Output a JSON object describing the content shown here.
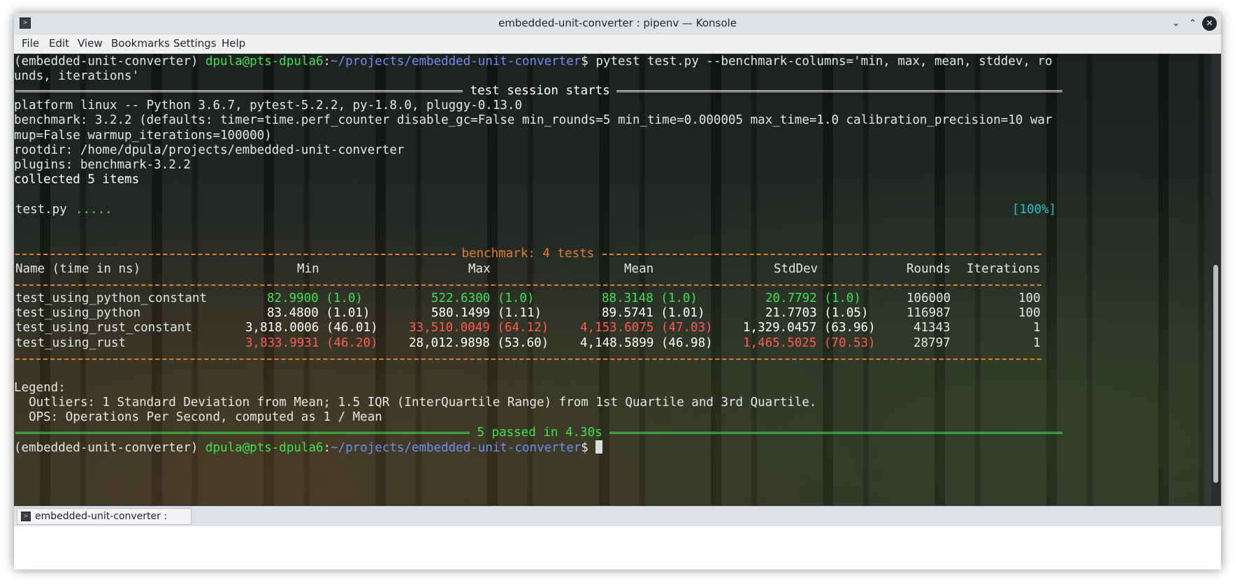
{
  "window": {
    "title": "embedded-unit-converter : pipenv — Konsole",
    "controls": {
      "minimize": "⌄",
      "maximize": "⌃",
      "close": "✕"
    }
  },
  "menu": [
    "File",
    "Edit",
    "View",
    "Bookmarks",
    "Settings",
    "Help"
  ],
  "prompt": {
    "env": "(embedded-unit-converter) ",
    "user_host": "dpula@pts-dpula6",
    "colon": ":",
    "path": "~/projects/embedded-unit-converter",
    "dollar": "$ "
  },
  "command": {
    "line1": "pytest test.py --benchmark-columns='min, max, mean, stddev, ro",
    "line2": "unds, iterations'"
  },
  "session": {
    "header": " test session starts ",
    "platform": "platform linux -- Python 3.6.7, pytest-5.2.2, py-1.8.0, pluggy-0.13.0",
    "benchmark_line1": "benchmark: 3.2.2 (defaults: timer=time.perf_counter disable_gc=False min_rounds=5 min_time=0.000005 max_time=1.0 calibration_precision=10 war",
    "benchmark_line2": "mup=False warmup_iterations=100000)",
    "rootdir": "rootdir: /home/dpula/projects/embedded-unit-converter",
    "plugins": "plugins: benchmark-3.2.2",
    "collected": "collected 5 items",
    "test_file": "test.py ",
    "test_dots": ".....",
    "progress": "[100%]"
  },
  "benchmark": {
    "header": " benchmark: 4 tests ",
    "columns": [
      "Name (time in ns)",
      "Min",
      "Max",
      "Mean",
      "StdDev",
      "Rounds",
      "Iterations"
    ],
    "rows": [
      {
        "name": "test_using_python_constant",
        "min": "82.9900 (1.0)",
        "max": "522.6300 (1.0)",
        "mean": "88.3148 (1.0)",
        "stddev": "20.7792 (1.0)",
        "rounds": "106000",
        "iterations": "100",
        "colors": {
          "min": "#3ee153",
          "max": "#3ee153",
          "mean": "#3ee153",
          "stddev": "#3ee153"
        }
      },
      {
        "name": "test_using_python",
        "min": "83.4800 (1.01)",
        "max": "580.1499 (1.11)",
        "mean": "89.5741 (1.01)",
        "stddev": "21.7703 (1.05)",
        "rounds": "116987",
        "iterations": "100",
        "colors": {
          "min": "#ffffff",
          "max": "#ffffff",
          "mean": "#ffffff",
          "stddev": "#ffffff"
        }
      },
      {
        "name": "test_using_rust_constant",
        "min": "3,818.0006 (46.01)",
        "max": "33,510.0049 (64.12)",
        "mean": "4,153.6075 (47.03)",
        "stddev": "1,329.0457 (63.96)",
        "rounds": "41343",
        "iterations": "1",
        "colors": {
          "min": "#ffffff",
          "max": "#ff5a55",
          "mean": "#ff5a55",
          "stddev": "#ffffff"
        }
      },
      {
        "name": "test_using_rust",
        "min": "3,833.9931 (46.20)",
        "max": "28,012.9898 (53.60)",
        "mean": "4,148.5899 (46.98)",
        "stddev": "1,465.5025 (70.53)",
        "rounds": "28797",
        "iterations": "1",
        "colors": {
          "min": "#ff5a55",
          "max": "#ffffff",
          "mean": "#ffffff",
          "stddev": "#ff5a55"
        }
      }
    ]
  },
  "legend": {
    "title": "Legend:",
    "outliers": "  Outliers: 1 Standard Deviation from Mean; 1.5 IQR (InterQuartile Range) from 1st Quartile and 3rd Quartile.",
    "ops": "  OPS: Operations Per Second, computed as 1 / Mean"
  },
  "summary": " 5 passed in 4.30s ",
  "tab": {
    "label": "embedded-unit-converter : pipenv"
  },
  "colors": {
    "green": "#3ee153",
    "blue": "#6e8ef2",
    "red": "#ff5a55",
    "orange": "#e07f2a",
    "cyan": "#1cc4c7"
  }
}
